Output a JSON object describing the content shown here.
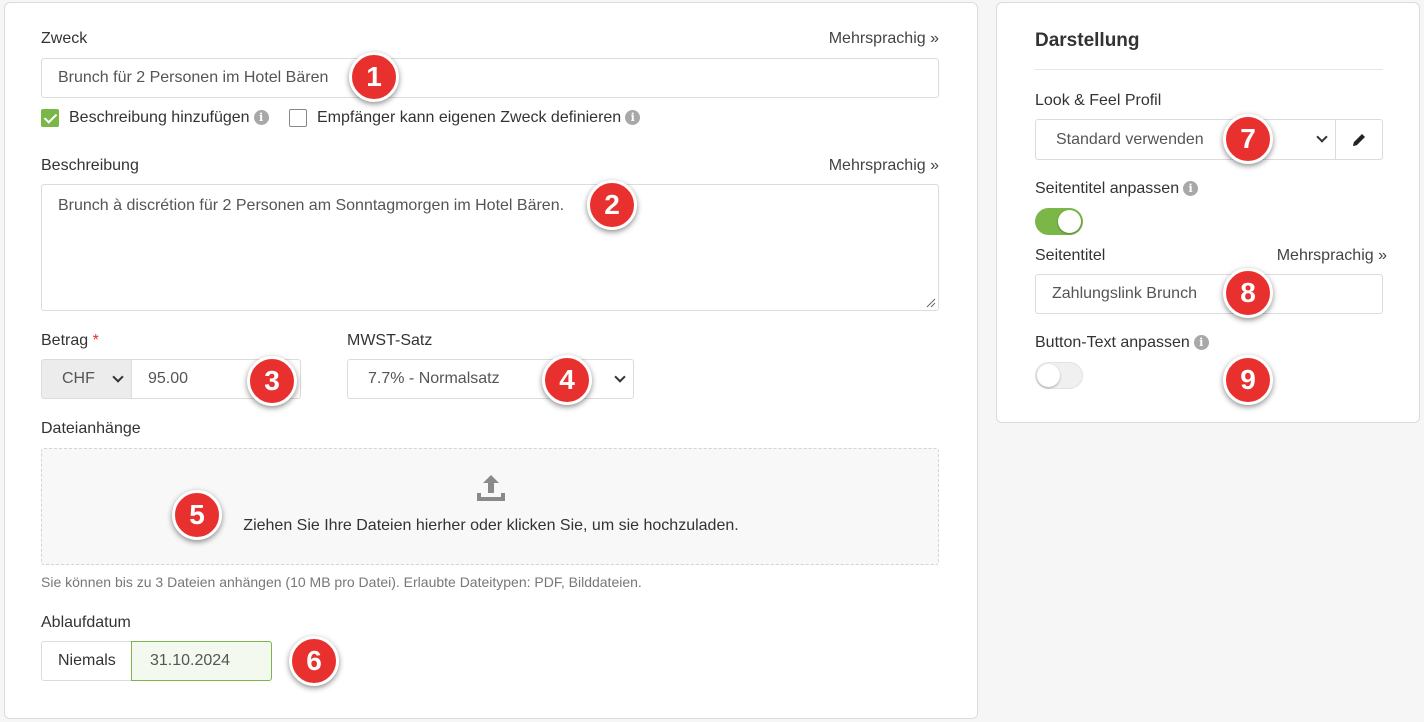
{
  "purpose": {
    "label": "Zweck",
    "multilang": "Mehrsprachig »",
    "value": "Brunch für 2 Personen im Hotel Bären",
    "add_description_label": "Beschreibung hinzufügen",
    "add_description_checked": true,
    "recipient_purpose_label": "Empfänger kann eigenen Zweck definieren",
    "recipient_purpose_checked": false
  },
  "description": {
    "label": "Beschreibung",
    "multilang": "Mehrsprachig »",
    "value": "Brunch à discrétion für 2 Personen am Sonntagmorgen im Hotel Bären."
  },
  "amount": {
    "label": "Betrag",
    "required_mark": "*",
    "currency": "CHF",
    "value": "95.00"
  },
  "vat": {
    "label": "MWST-Satz",
    "selected": "7.7% - Normalsatz"
  },
  "attachments": {
    "label": "Dateianhänge",
    "drop_text": "Ziehen Sie Ihre Dateien hierher oder klicken Sie, um sie hochzuladen.",
    "hint": "Sie können bis zu 3 Dateien anhängen (10 MB pro Datei). Erlaubte Dateitypen: PDF, Bilddateien."
  },
  "expiry": {
    "label": "Ablaufdatum",
    "never_label": "Niemals",
    "date": "31.10.2024"
  },
  "appearance": {
    "title": "Darstellung",
    "profile_label": "Look & Feel Profil",
    "profile_selected": "Standard verwenden",
    "custom_title_label": "Seitentitel anpassen",
    "custom_title_on": true,
    "page_title_label": "Seitentitel",
    "page_title_multilang": "Mehrsprachig »",
    "page_title_value": "Zahlungslink Brunch",
    "custom_button_label": "Button-Text anpassen",
    "custom_button_on": false
  },
  "callouts": [
    "1",
    "2",
    "3",
    "4",
    "5",
    "6",
    "7",
    "8",
    "9"
  ],
  "colors": {
    "accent_green": "#7ab648",
    "callout_red": "#e8302e"
  }
}
